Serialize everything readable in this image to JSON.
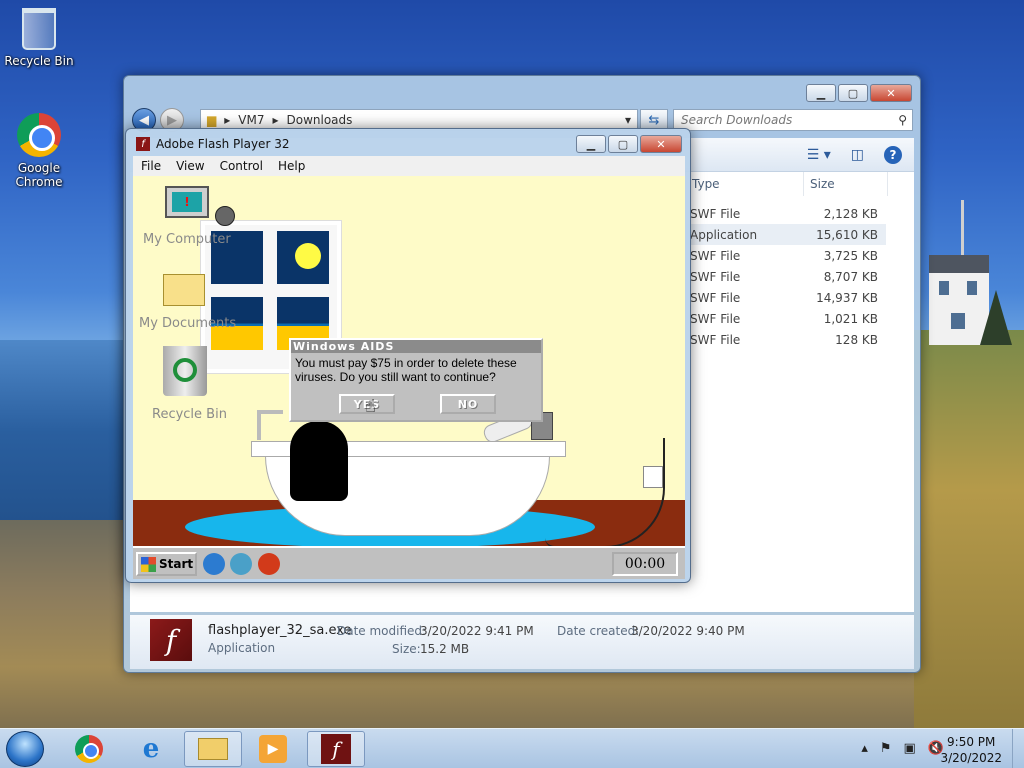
{
  "desktop": {
    "icons": [
      {
        "label": "Recycle Bin",
        "icon": "recycle-bin-icon"
      },
      {
        "label": "Google Chrome",
        "icon": "chrome-icon"
      }
    ]
  },
  "explorer": {
    "breadcrumb": [
      "VM7",
      "Downloads"
    ],
    "search_placeholder": "Search Downloads",
    "columns": {
      "type": "Type",
      "size": "Size"
    },
    "rows": [
      {
        "type": "SWF File",
        "size": "2,128 KB"
      },
      {
        "type": "Application",
        "size": "15,610 KB",
        "selected": true
      },
      {
        "type": "SWF File",
        "size": "3,725 KB"
      },
      {
        "type": "SWF File",
        "size": "8,707 KB"
      },
      {
        "type": "SWF File",
        "size": "14,937 KB"
      },
      {
        "type": "SWF File",
        "size": "1,021 KB"
      },
      {
        "type": "SWF File",
        "size": "128 KB"
      }
    ],
    "details": {
      "filename": "flashplayer_32_sa.exe",
      "filetype": "Application",
      "date_modified_label": "Date modified:",
      "date_modified": "3/20/2022 9:41 PM",
      "size_label": "Size:",
      "size": "15.2 MB",
      "date_created_label": "Date created:",
      "date_created": "3/20/2022 9:40 PM"
    }
  },
  "flash": {
    "title": "Adobe Flash Player 32",
    "menu": [
      "File",
      "View",
      "Control",
      "Help"
    ],
    "stage": {
      "icons": {
        "computer": "My Computer",
        "documents": "My Documents",
        "recycle": "Recycle Bin"
      },
      "start_label": "Start",
      "clock": "00:00",
      "dialog": {
        "title": "Windows AIDS",
        "message": "You must pay $75 in order to delete these viruses. Do you still want to continue?",
        "yes": "YES",
        "no": "NO"
      }
    }
  },
  "taskbar": {
    "time": "9:50 PM",
    "date": "3/20/2022"
  }
}
